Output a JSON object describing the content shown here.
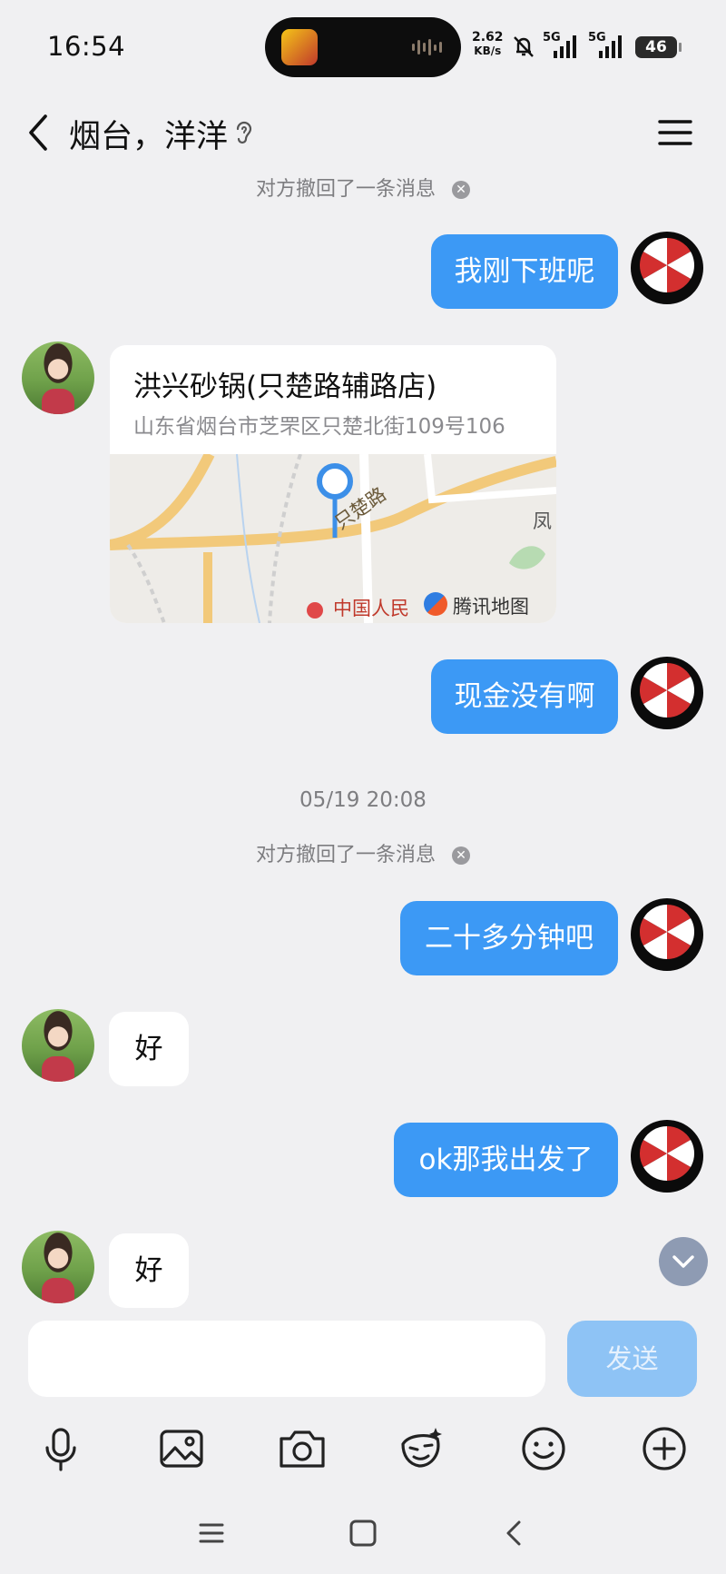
{
  "status_bar": {
    "time": "16:54",
    "net_speed_value": "2.62",
    "net_speed_unit": "KB/s",
    "network_1": "5G",
    "network_2": "5G",
    "battery": "46"
  },
  "header": {
    "title": "烟台，洋洋"
  },
  "messages": {
    "recall_notice": "对方撤回了一条消息",
    "msg_1": "我刚下班呢",
    "location": {
      "name": "洪兴砂锅(只楚路辅路店)",
      "address": "山东省烟台市芝罘区只楚北街109号106",
      "map_road": "只楚路",
      "map_hospital": "中国人民",
      "map_partial": "凤",
      "map_brand": "腾讯地图"
    },
    "msg_2": "现金没有啊",
    "timestamp": "05/19 20:08",
    "recall_notice_2": "对方撤回了一条消息",
    "msg_3": "二十多分钟吧",
    "reply_1": "好",
    "msg_4": "ok那我出发了",
    "reply_2": "好"
  },
  "composer": {
    "send_label": "发送"
  },
  "colors": {
    "accent": "#3c99f5",
    "send_disabled": "#8ec3f5",
    "background": "#f0f0f2"
  }
}
